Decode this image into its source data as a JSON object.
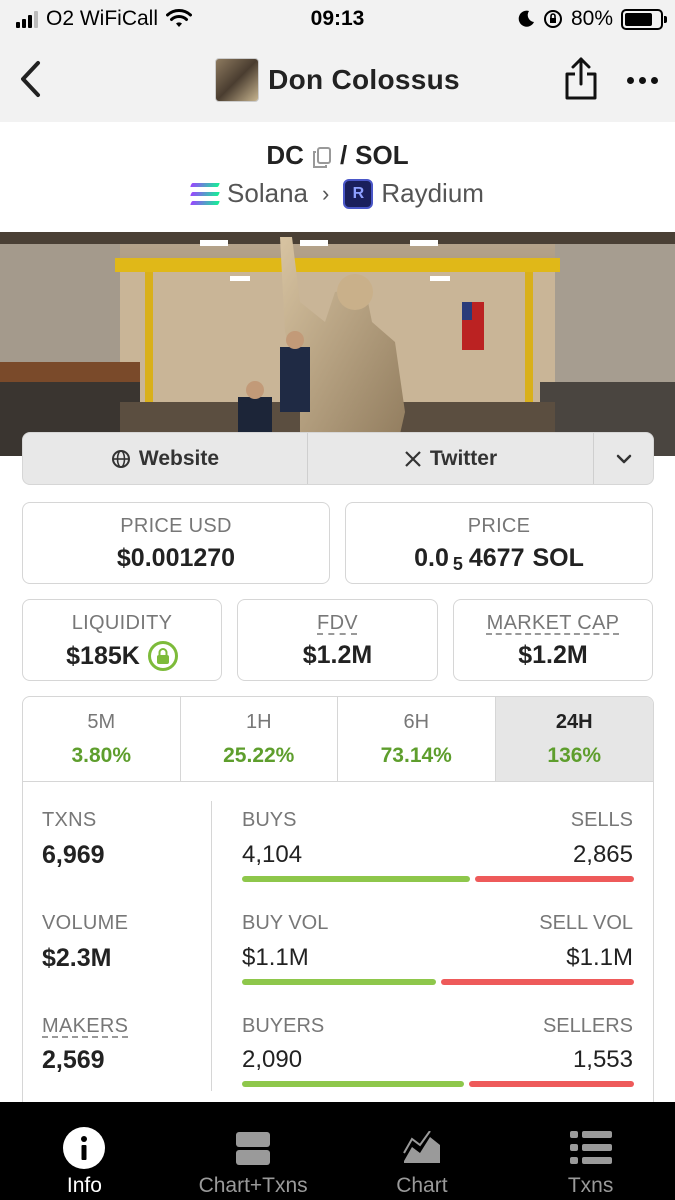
{
  "status_bar": {
    "carrier": "O2 WiFiCall",
    "time": "09:13",
    "battery": "80%",
    "battery_level": 0.8
  },
  "nav": {
    "title": "Don Colossus"
  },
  "pair": {
    "base": "DC",
    "separator": "/",
    "quote": "SOL",
    "chain": "Solana",
    "dex": "Raydium"
  },
  "links": {
    "website": "Website",
    "twitter": "Twitter"
  },
  "price_usd": {
    "label": "PRICE USD",
    "value": "$0.001270"
  },
  "price_native": {
    "label": "PRICE",
    "prefix": "0.0",
    "zeros": "5",
    "digits": "4677",
    "unit": "SOL"
  },
  "liquidity": {
    "label": "LIQUIDITY",
    "value": "$185K"
  },
  "fdv": {
    "label": "FDV",
    "value": "$1.2M"
  },
  "market_cap": {
    "label": "MARKET CAP",
    "value": "$1.2M"
  },
  "timeframes": [
    {
      "label": "5M",
      "change": "3.80%"
    },
    {
      "label": "1H",
      "change": "25.22%"
    },
    {
      "label": "6H",
      "change": "73.14%"
    },
    {
      "label": "24H",
      "change": "136%"
    }
  ],
  "active_timeframe": "24H",
  "stats": {
    "txns": {
      "label": "TXNS",
      "value": "6,969"
    },
    "volume": {
      "label": "VOLUME",
      "value": "$2.3M"
    },
    "makers": {
      "label": "MAKERS",
      "value": "2,569"
    },
    "buys": {
      "label": "BUYS",
      "value": "4,104",
      "share": 0.589
    },
    "sells": {
      "label": "SELLS",
      "value": "2,865"
    },
    "buy_vol": {
      "label": "BUY VOL",
      "value": "$1.1M",
      "share": 0.5
    },
    "sell_vol": {
      "label": "SELL VOL",
      "value": "$1.1M"
    },
    "buyers": {
      "label": "BUYERS",
      "value": "2,090",
      "share": 0.574
    },
    "sellers": {
      "label": "SELLERS",
      "value": "1,553"
    }
  },
  "colors": {
    "positive": "#5e9e2d",
    "buy_bar": "#8ec74b",
    "sell_bar": "#ee5a5a"
  },
  "tabbar": [
    {
      "label": "Info",
      "icon": "info-icon"
    },
    {
      "label": "Chart+Txns",
      "icon": "chart-txns-icon"
    },
    {
      "label": "Chart",
      "icon": "area-chart-icon"
    },
    {
      "label": "Txns",
      "icon": "list-icon"
    }
  ]
}
